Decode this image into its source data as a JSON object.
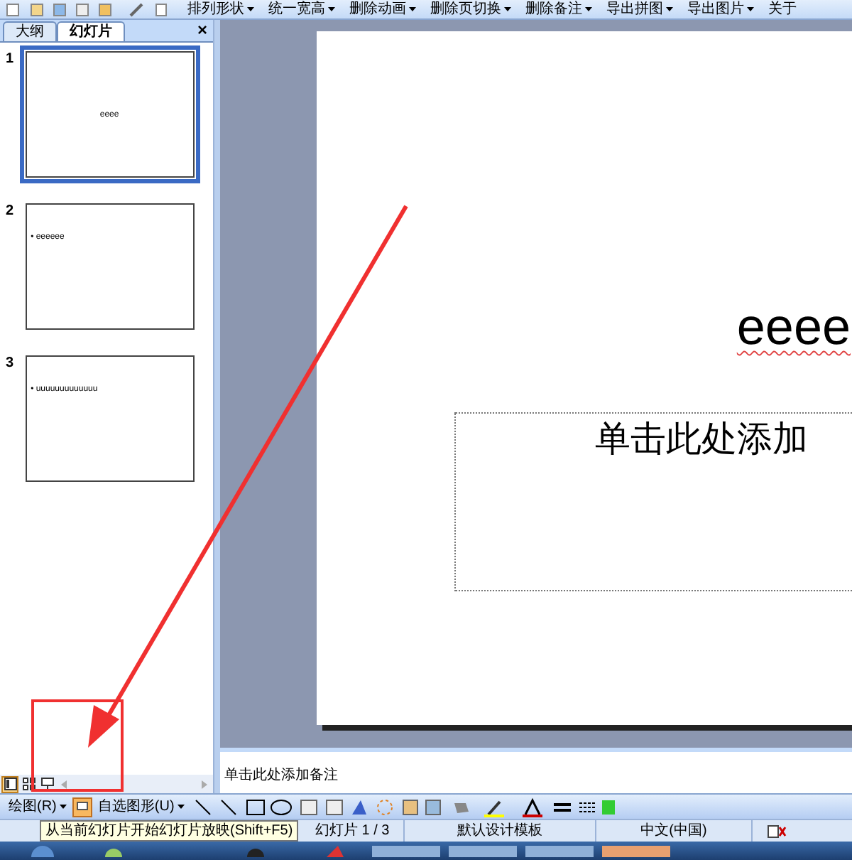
{
  "toolbar": {
    "items": [
      {
        "label": "排列形状",
        "dropdown": true
      },
      {
        "label": "统一宽高",
        "dropdown": true
      },
      {
        "label": "删除动画",
        "dropdown": true
      },
      {
        "label": "删除页切换",
        "dropdown": true
      },
      {
        "label": "删除备注",
        "dropdown": true
      },
      {
        "label": "导出拼图",
        "dropdown": true
      },
      {
        "label": "导出图片",
        "dropdown": true
      },
      {
        "label": "关于",
        "dropdown": false
      }
    ]
  },
  "side_pane": {
    "tabs": [
      {
        "label": "大纲",
        "selected": false
      },
      {
        "label": "幻灯片",
        "selected": true
      }
    ],
    "close": "×",
    "slides": [
      {
        "number": "1",
        "kind": "title",
        "text": "eeee",
        "selected": true
      },
      {
        "number": "2",
        "kind": "bullet",
        "text": "• eeeeee",
        "selected": false
      },
      {
        "number": "3",
        "kind": "bullet",
        "text": "• uuuuuuuuuuuuu",
        "selected": false
      }
    ],
    "views": [
      {
        "kind": "normal",
        "selected": true
      },
      {
        "kind": "sorter",
        "selected": false
      },
      {
        "kind": "show",
        "selected": false
      }
    ]
  },
  "slide": {
    "title": "eeee",
    "subtitle_placeholder": "单击此处添加"
  },
  "notes": {
    "placeholder": "单击此处添加备注"
  },
  "drawing_toolbar": {
    "draw_menu": "绘图(R)",
    "autoshapes_menu": "自选图形(U)"
  },
  "tooltip": "从当前幻灯片开始幻灯片放映(Shift+F5)",
  "status_bar": [
    "幻灯片 1 / 3",
    "默认设计模板",
    "中文(中国)"
  ]
}
